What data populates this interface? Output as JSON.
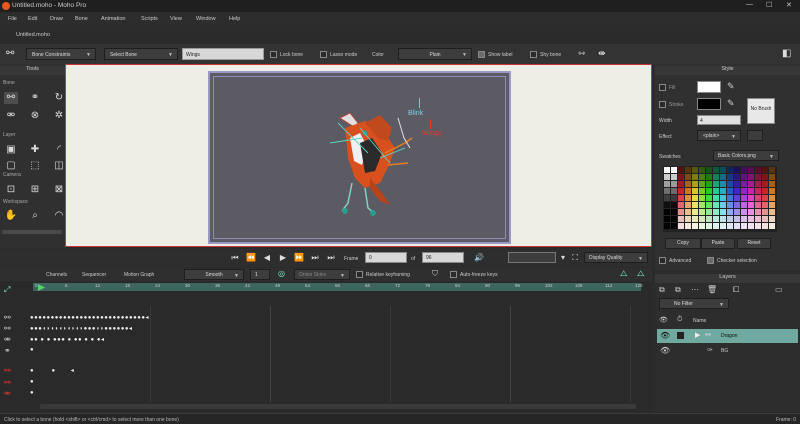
{
  "window": {
    "title": "Untitled.moho - Moho Pro",
    "minimize": "—",
    "maximize": "☐",
    "close": "✕"
  },
  "menu": [
    "File",
    "Edit",
    "Draw",
    "Bone",
    "Animation",
    "Scripts",
    "View",
    "Window",
    "Help"
  ],
  "doc_tab": "Untitled.moho",
  "toolbar": {
    "bone_constraints": "Bone Constraints",
    "select_bone": "Select Bone",
    "bone_name": "Wings",
    "lock_bone": "Lock bone",
    "lasso_mode": "Lasso mode",
    "color_label": "Color",
    "color_value": "Plain",
    "show_label": "Show label",
    "shy_bone": "Shy bone"
  },
  "tools_panel": {
    "title": "Tools",
    "sections": [
      "Bone",
      "Layer",
      "Camera",
      "Workspace"
    ]
  },
  "canvas": {
    "label_blink": "Blink",
    "label_wings": "Wings"
  },
  "style_panel": {
    "title": "Style",
    "fill": "Fill",
    "stroke": "Stroke",
    "width_label": "Width",
    "width_value": "4",
    "effect_label": "Effect",
    "effect_value": "<plain>",
    "no_brush": "No Brush",
    "swatches_label": "Swatches",
    "swatches_value": "Basic Colors.png",
    "copy": "Copy",
    "paste": "Paste",
    "reset": "Reset",
    "advanced": "Advanced",
    "checker": "Checker selection"
  },
  "playback": {
    "frame_label": "Frame",
    "frame_value": "0",
    "of_label": "of",
    "total_frames": "96",
    "display_quality": "Display Quality"
  },
  "timeline": {
    "tabs": [
      "Channels",
      "Sequencer",
      "Motion Graph"
    ],
    "interp": "Smooth",
    "interp_count": "1",
    "onion": "Onion Skins",
    "relative_keyframing": "Relative keyframing",
    "auto_freeze": "Auto-freeze keys",
    "ruler": [
      "0",
      "6",
      "12",
      "18",
      "24",
      "30",
      "36",
      "42",
      "48",
      "54",
      "60",
      "66",
      "72",
      "78",
      "84",
      "90",
      "96",
      "102",
      "108",
      "114",
      "120"
    ]
  },
  "layers_panel": {
    "title": "Layers",
    "filter": "No Filter",
    "name_col": "Name",
    "layers": [
      {
        "name": "Dragon",
        "selected": true
      },
      {
        "name": "BG",
        "selected": false
      }
    ]
  },
  "status": {
    "hint": "Click to select a bone (hold <shift> or <ctrl/cmd> to select more than one bone)",
    "frame": "Frame: 0"
  },
  "colors": {
    "accent": "#3d6660",
    "selected_layer": "#6fa9a0",
    "canvas_bg": "#5c5a62",
    "frame_border": "#9a98c4"
  }
}
